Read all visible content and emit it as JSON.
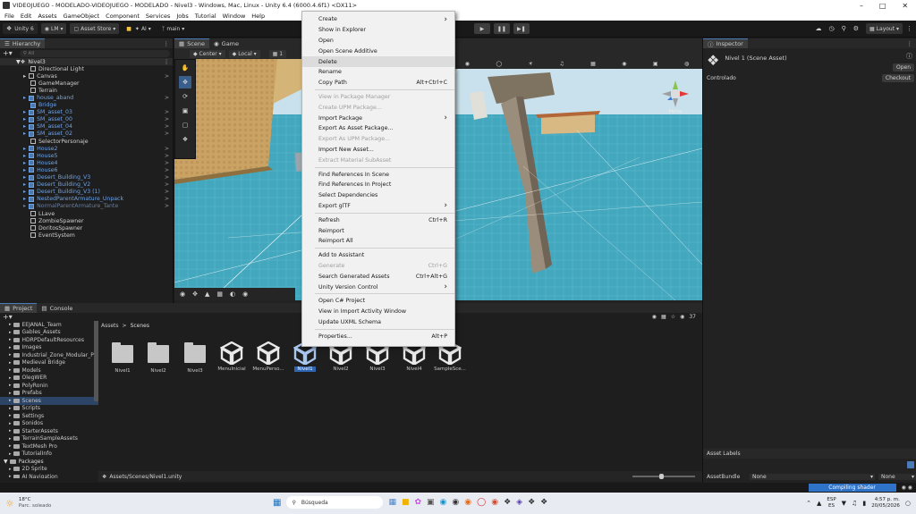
{
  "window": {
    "title": "VIDEOJUEGO - MODELADO-VIDEOJUEGO - MODELADO - Nivel3 - Windows, Mac, Linux - Unity 6.4 (6000.4.6f1) <DX11>"
  },
  "menubar": [
    "File",
    "Edit",
    "Assets",
    "GameObject",
    "Component",
    "Services",
    "Jobs",
    "Tutorial",
    "Window",
    "Help"
  ],
  "toolbar": {
    "unity_label": "Unity 6",
    "account": "LM",
    "asset_store": "Asset Store",
    "ai": "AI",
    "branch": "main",
    "layout": "Layout"
  },
  "hierarchy": {
    "tab": "Hierarchy",
    "search_placeholder": "All",
    "scene": "Nivel3",
    "items": [
      {
        "label": "Directional Light",
        "type": "plain",
        "expand": false
      },
      {
        "label": "Canvas",
        "type": "plain",
        "expand": true
      },
      {
        "label": "GameManager",
        "type": "plain",
        "expand": false
      },
      {
        "label": "Terrain",
        "type": "plain",
        "expand": false
      },
      {
        "label": "house_aband",
        "type": "blue",
        "expand": true
      },
      {
        "label": "Bridge",
        "type": "blue",
        "expand": false
      },
      {
        "label": "SM_asset_03",
        "type": "blue",
        "expand": true
      },
      {
        "label": "SM_asset_00",
        "type": "blue",
        "expand": true
      },
      {
        "label": "SM_asset_04",
        "type": "blue",
        "expand": true
      },
      {
        "label": "SM_asset_02",
        "type": "blue",
        "expand": true
      },
      {
        "label": "SelectorPersonaje",
        "type": "plain",
        "expand": false
      },
      {
        "label": "House2",
        "type": "blue",
        "expand": true
      },
      {
        "label": "House5",
        "type": "blue",
        "expand": true
      },
      {
        "label": "House4",
        "type": "blue",
        "expand": true
      },
      {
        "label": "House6",
        "type": "blue",
        "expand": true
      },
      {
        "label": "Desert_Building_V3",
        "type": "blue",
        "expand": true
      },
      {
        "label": "Desert_Building_V2",
        "type": "blue",
        "expand": true
      },
      {
        "label": "Desert_Building_V3 (1)",
        "type": "blue",
        "expand": true
      },
      {
        "label": "NestedParentArmature_Unpack",
        "type": "blue",
        "expand": true
      },
      {
        "label": "NormalParentArmature_Tante",
        "type": "dim",
        "expand": true
      },
      {
        "label": "LLave",
        "type": "plain",
        "expand": false
      },
      {
        "label": "ZombieSpawner",
        "type": "plain",
        "expand": false
      },
      {
        "label": "DoritosSpawner",
        "type": "plain",
        "expand": false
      },
      {
        "label": "EventSystem",
        "type": "plain",
        "expand": false
      }
    ]
  },
  "scene": {
    "tab_scene": "Scene",
    "tab_game": "Game",
    "pivot": "Center",
    "space": "Local",
    "grid_value": "1",
    "persp": "Persp"
  },
  "inspector": {
    "tab": "Inspector",
    "title": "Nivel 1 (Scene Asset)",
    "open_button": "Open",
    "controlado_label": "Controlado",
    "checkout_button": "Checkout",
    "asset_labels": "Asset Labels",
    "asset_bundle_label": "AssetBundle",
    "asset_bundle_value": "None",
    "asset_bundle_variant": "None"
  },
  "project": {
    "tab_project": "Project",
    "tab_console": "Console",
    "breadcrumb": [
      "Assets",
      "Scenes"
    ],
    "count": "37",
    "tree": [
      "EEJANAL_Team",
      "Gables_Assets",
      "HDRPDefaultResources",
      "Images",
      "Industrial_Zone_Modular_P",
      "Medieval Bridge",
      "Models",
      "OlegWER",
      "PolyRonin",
      "Prefabs",
      "Scenes",
      "Scripts",
      "Settings",
      "Sonidos",
      "StarterAssets",
      "TerrainSampleAssets",
      "TextMesh Pro",
      "TutorialInfo"
    ],
    "packages": "Packages",
    "packages_items": [
      "2D Sprite",
      "AI Navigation"
    ],
    "assets": [
      {
        "label": "Nivel1",
        "kind": "folder"
      },
      {
        "label": "Nivel2",
        "kind": "folder"
      },
      {
        "label": "Nivel3",
        "kind": "folder"
      },
      {
        "label": "MenuInicial",
        "kind": "unity"
      },
      {
        "label": "MenuPerso...",
        "kind": "unity"
      },
      {
        "label": "Nivel1",
        "kind": "unity",
        "selected": true
      },
      {
        "label": "Nivel2",
        "kind": "unity"
      },
      {
        "label": "Nivel3",
        "kind": "unity"
      },
      {
        "label": "Nivel4",
        "kind": "unity"
      },
      {
        "label": "SampleSce...",
        "kind": "unity"
      }
    ],
    "path": "Assets/Scenes/Nivel1.unity"
  },
  "context_menu": [
    {
      "label": "Create",
      "shortcut": "",
      "arrow": true,
      "disabled": false
    },
    {
      "label": "Show in Explorer",
      "shortcut": "",
      "arrow": false,
      "disabled": false
    },
    {
      "label": "Open",
      "shortcut": "",
      "arrow": false,
      "disabled": false
    },
    {
      "label": "Open Scene Additive",
      "shortcut": "",
      "arrow": false,
      "disabled": false
    },
    {
      "label": "Delete",
      "shortcut": "",
      "arrow": false,
      "disabled": false,
      "highlight": true
    },
    {
      "label": "Rename",
      "shortcut": "",
      "arrow": false,
      "disabled": false
    },
    {
      "label": "Copy Path",
      "shortcut": "Alt+Ctrl+C",
      "arrow": false,
      "disabled": false
    },
    {
      "sep": true
    },
    {
      "label": "View in Package Manager",
      "shortcut": "",
      "arrow": false,
      "disabled": true
    },
    {
      "label": "Create UPM Package...",
      "shortcut": "",
      "arrow": false,
      "disabled": true
    },
    {
      "label": "Import Package",
      "shortcut": "",
      "arrow": true,
      "disabled": false
    },
    {
      "label": "Export As Asset Package...",
      "shortcut": "",
      "arrow": false,
      "disabled": false
    },
    {
      "label": "Export As UPM Package...",
      "shortcut": "",
      "arrow": false,
      "disabled": true
    },
    {
      "label": "Import New Asset...",
      "shortcut": "",
      "arrow": false,
      "disabled": false
    },
    {
      "label": "Extract Material SubAsset",
      "shortcut": "",
      "arrow": false,
      "disabled": true
    },
    {
      "sep": true
    },
    {
      "label": "Find References In Scene",
      "shortcut": "",
      "arrow": false,
      "disabled": false
    },
    {
      "label": "Find References In Project",
      "shortcut": "",
      "arrow": false,
      "disabled": false
    },
    {
      "label": "Select Dependencies",
      "shortcut": "",
      "arrow": false,
      "disabled": false
    },
    {
      "label": "Export glTF",
      "shortcut": "",
      "arrow": true,
      "disabled": false
    },
    {
      "sep": true
    },
    {
      "label": "Refresh",
      "shortcut": "Ctrl+R",
      "arrow": false,
      "disabled": false
    },
    {
      "label": "Reimport",
      "shortcut": "",
      "arrow": false,
      "disabled": false
    },
    {
      "label": "Reimport All",
      "shortcut": "",
      "arrow": false,
      "disabled": false
    },
    {
      "sep": true
    },
    {
      "label": "Add to Assistant",
      "shortcut": "",
      "arrow": false,
      "disabled": false
    },
    {
      "label": "Generate",
      "shortcut": "Ctrl+G",
      "arrow": false,
      "disabled": true
    },
    {
      "label": "Search Generated Assets",
      "shortcut": "Ctrl+Alt+G",
      "arrow": false,
      "disabled": false
    },
    {
      "label": "Unity Version Control",
      "shortcut": "",
      "arrow": true,
      "disabled": false
    },
    {
      "sep": true
    },
    {
      "label": "Open C# Project",
      "shortcut": "",
      "arrow": false,
      "disabled": false
    },
    {
      "label": "View in Import Activity Window",
      "shortcut": "",
      "arrow": false,
      "disabled": false
    },
    {
      "label": "Update UXML Schema",
      "shortcut": "",
      "arrow": false,
      "disabled": false
    },
    {
      "sep": true
    },
    {
      "label": "Properties...",
      "shortcut": "Alt+P",
      "arrow": false,
      "disabled": false
    }
  ],
  "status": {
    "compiling": "Compiling shader"
  },
  "taskbar": {
    "weather_temp": "18°C",
    "weather_desc": "Parc. soleado",
    "search_placeholder": "Búsqueda",
    "lang": "ESP",
    "lang_sub": "ES",
    "time": "4:57 p. m.",
    "date": "20/05/2026"
  },
  "colors": {
    "accent": "#4a7ab8",
    "prefab_blue": "#6ea3e6",
    "progress": "#2f73c9"
  }
}
